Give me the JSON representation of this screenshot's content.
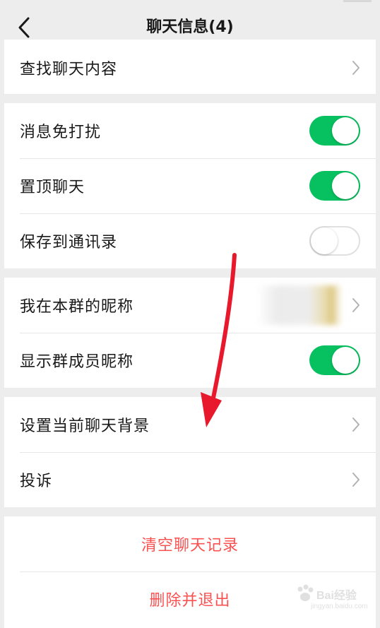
{
  "header": {
    "title": "聊天信息(4)",
    "back_icon": "chevron-left-icon"
  },
  "groups": {
    "search": {
      "find_chat": "查找聊天内容"
    },
    "toggles": {
      "mute": {
        "label": "消息免打扰",
        "on": true
      },
      "pin": {
        "label": "置顶聊天",
        "on": true
      },
      "save_contacts": {
        "label": "保存到通讯录",
        "on": false
      }
    },
    "nickname": {
      "my_nickname": "我在本群的昵称",
      "show_member_nicknames": {
        "label": "显示群成员昵称",
        "on": true
      }
    },
    "misc": {
      "set_background": "设置当前聊天背景",
      "complain": "投诉"
    },
    "danger": {
      "clear_history": "清空聊天记录",
      "delete_exit": "删除并退出"
    }
  },
  "colors": {
    "toggle_on": "#07c160",
    "danger_text": "#fa5151",
    "annotation_arrow": "#e8192c"
  },
  "watermark": {
    "brand": "Bai",
    "brand_cn": "经验",
    "url": "jingyan.baidu.com"
  }
}
